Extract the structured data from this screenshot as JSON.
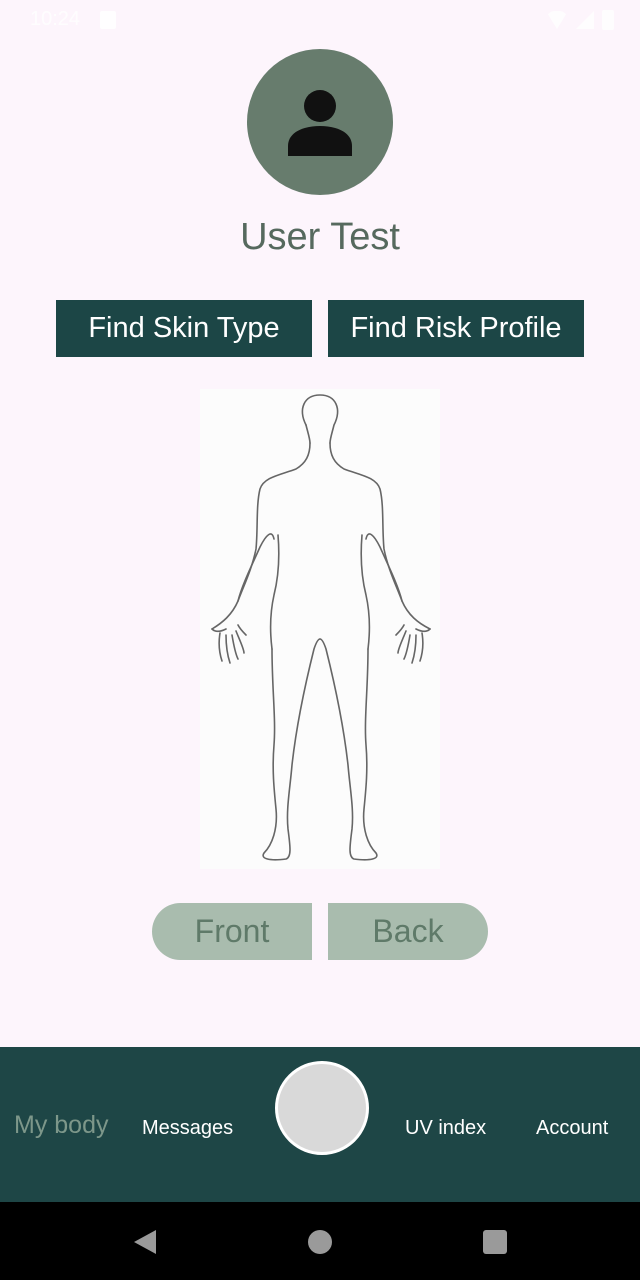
{
  "status_bar": {
    "time": "10:24"
  },
  "profile": {
    "name": "User Test",
    "avatar_icon": "person-icon"
  },
  "actions": {
    "skin_type": "Find Skin Type",
    "risk_profile": "Find Risk Profile"
  },
  "view_toggle": {
    "front": "Front",
    "back": "Back"
  },
  "bottom_nav": {
    "items": [
      {
        "label": "My body",
        "active": true
      },
      {
        "label": "Messages"
      },
      {
        "label": "UV index"
      },
      {
        "label": "Account"
      }
    ],
    "center_icon": "camera-button"
  },
  "colors": {
    "background": "#fdf5fc",
    "primary": "#1c4646",
    "avatar": "#677c6d",
    "toggle": "#a9bcae",
    "nav_inactive_active_text": "#7d978a"
  }
}
